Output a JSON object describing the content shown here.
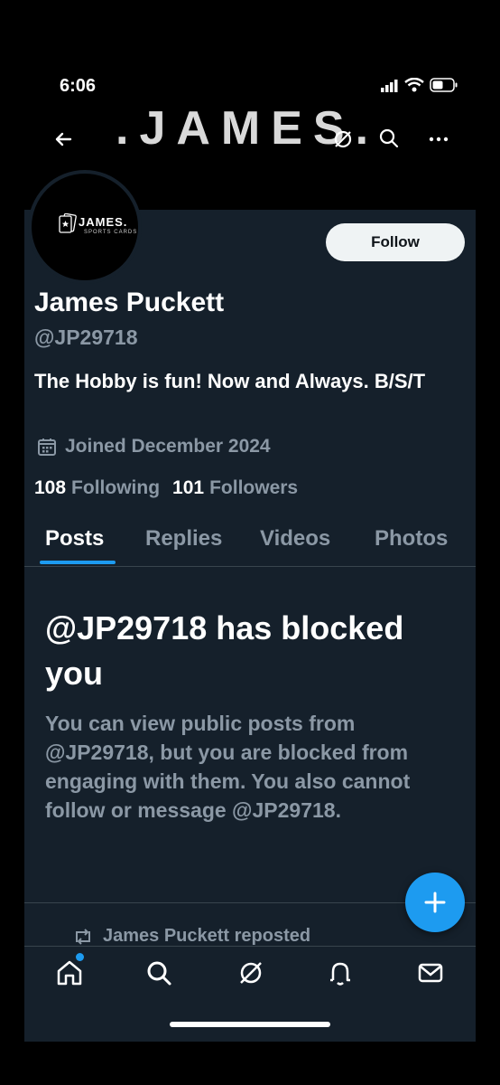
{
  "status_bar": {
    "time": "6:06"
  },
  "banner": {
    "text": ".JAMES."
  },
  "avatar": {
    "logo_name": "JAMES.",
    "logo_sub": "SPORTS CARDS"
  },
  "profile": {
    "follow_label": "Follow",
    "display_name": "James Puckett",
    "handle": "@JP29718",
    "bio": "The Hobby is fun! Now and Always. B/S/T",
    "joined": "Joined December 2024",
    "following_count": "108",
    "following_label": "Following",
    "followers_count": "101",
    "followers_label": "Followers"
  },
  "tabs": [
    {
      "label": "Posts",
      "active": true
    },
    {
      "label": "Replies",
      "active": false
    },
    {
      "label": "Videos",
      "active": false
    },
    {
      "label": "Photos",
      "active": false
    }
  ],
  "blocked": {
    "title": "@JP29718 has blocked you",
    "description": "You can view public posts from @JP29718, but you are blocked from engaging with them. You also cannot follow or message @JP29718."
  },
  "repost": {
    "text": "James Puckett reposted"
  },
  "colors": {
    "accent": "#1d9bf0",
    "background": "#15202b",
    "secondary_text": "#8b98a5"
  },
  "icons": {
    "top_bar": [
      "back-arrow-icon",
      "grok-icon",
      "search-icon",
      "more-icon"
    ],
    "bottom_nav": [
      "home-icon",
      "search-icon",
      "grok-icon",
      "notifications-icon",
      "messages-icon"
    ]
  }
}
